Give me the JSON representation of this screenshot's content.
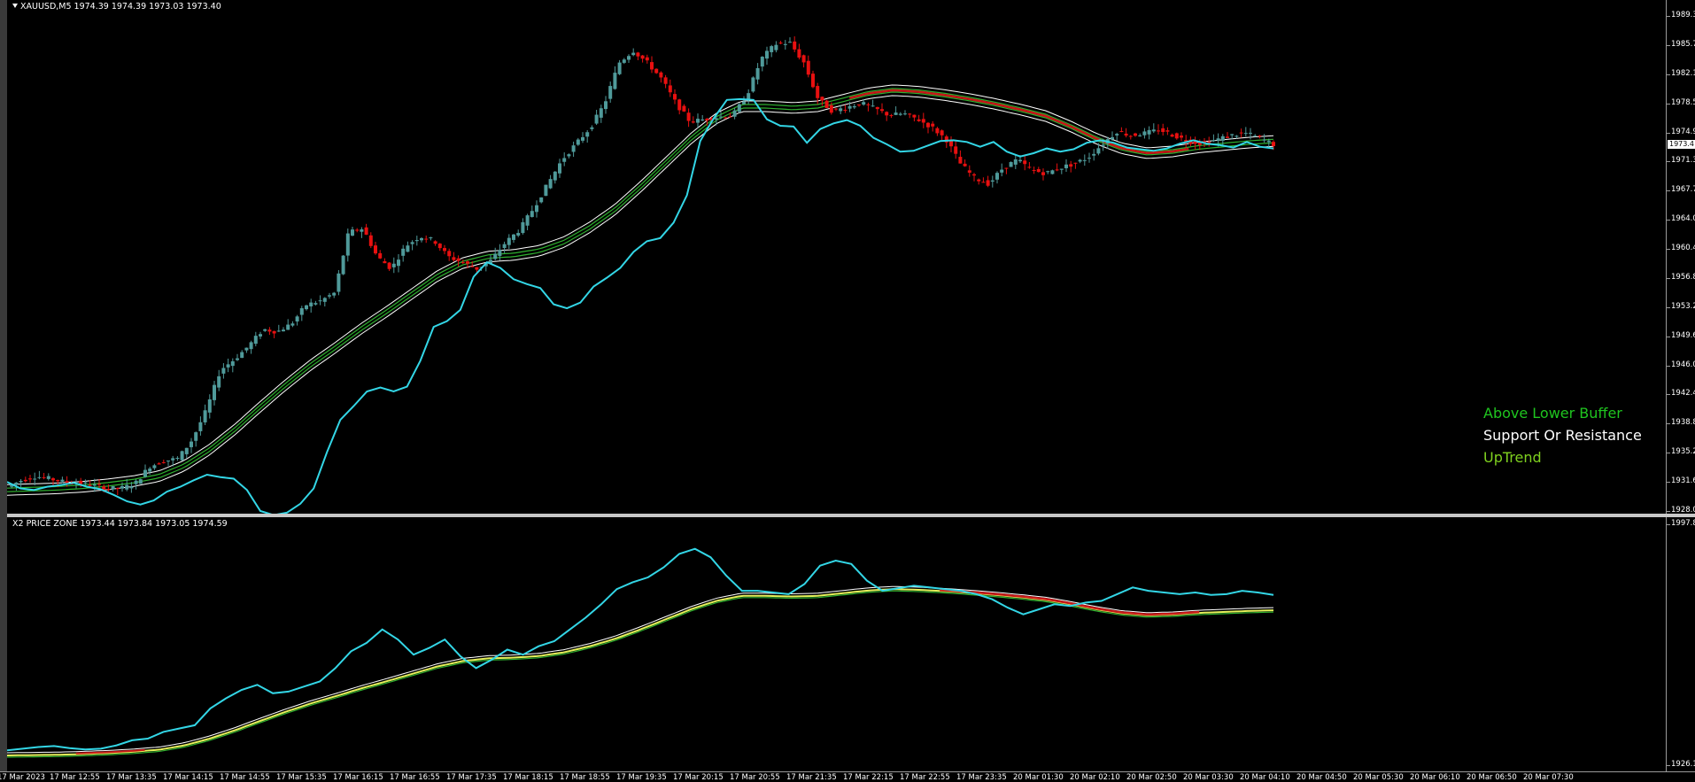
{
  "window": {
    "symbol_header": "XAUUSD,M5  1974.39 1974.39 1973.03 1973.40",
    "subwindow_header": "X2 PRICE ZONE 1973.44 1973.84 1973.05 1974.59",
    "current_price": "1973.4"
  },
  "legend": {
    "line1": "Above Lower Buffer",
    "line2": "Support Or Resistance",
    "line3": "UpTrend",
    "color1": "#1fc51f",
    "color2": "#ffffff",
    "color3": "#7fd11f"
  },
  "colors": {
    "bull": "#4f9a9a",
    "bear": "#e81010",
    "cyan": "#33d6e6",
    "ema_white": "#ffffff",
    "ema_green": "#2fb02f",
    "ema_red": "#c81818",
    "zone_yellow": "#e6f05a"
  },
  "main_axis": {
    "labels": [
      "1989.3",
      "1985.7",
      "1982.1",
      "1978.5",
      "1974.9",
      "1971.3",
      "1967.7",
      "1964.0",
      "1960.4",
      "1956.8",
      "1953.2",
      "1949.6",
      "1946.0",
      "1942.4",
      "1938.8",
      "1935.2",
      "1931.6",
      "1928.0"
    ],
    "min": 1928.0,
    "max": 1989.3
  },
  "sub_axis": {
    "labels": [
      "1997.8",
      "1926.1"
    ],
    "min": 1926.1,
    "max": 1997.8
  },
  "time_axis": {
    "labels": [
      "17 Mar 2023",
      "17 Mar 12:55",
      "17 Mar 13:35",
      "17 Mar 14:15",
      "17 Mar 14:55",
      "17 Mar 15:35",
      "17 Mar 16:15",
      "17 Mar 16:55",
      "17 Mar 17:35",
      "17 Mar 18:15",
      "17 Mar 18:55",
      "17 Mar 19:35",
      "17 Mar 20:15",
      "17 Mar 20:55",
      "17 Mar 21:35",
      "17 Mar 22:15",
      "17 Mar 22:55",
      "17 Mar 23:35",
      "20 Mar 01:30",
      "20 Mar 02:10",
      "20 Mar 02:50",
      "20 Mar 03:30",
      "20 Mar 04:10",
      "20 Mar 04:50",
      "20 Mar 05:30",
      "20 Mar 06:10",
      "20 Mar 06:50",
      "20 Mar 07:30"
    ]
  },
  "chart_data": {
    "type": "line",
    "close_anchors": [
      1931.0,
      1931.8,
      1932.3,
      1932.0,
      1931.6,
      1931.5,
      1931.2,
      1930.8,
      1930.8,
      1931.4,
      1933.5,
      1934.2,
      1934.5,
      1936.8,
      1940.5,
      1945.5,
      1946.8,
      1948.5,
      1950.5,
      1950.2,
      1951.2,
      1953.5,
      1954.0,
      1955.0,
      1962.5,
      1963.0,
      1959.5,
      1958.0,
      1960.8,
      1962.0,
      1961.5,
      1959.5,
      1958.8,
      1958.0,
      1959.0,
      1961.2,
      1962.8,
      1965.5,
      1968.5,
      1971.5,
      1973.5,
      1975.5,
      1978.5,
      1983.5,
      1985.0,
      1983.5,
      1981.5,
      1978.5,
      1976.2,
      1976.5,
      1976.8,
      1977.0,
      1979.5,
      1984.0,
      1985.8,
      1986.0,
      1983.5,
      1979.0,
      1977.5,
      1978.0,
      1978.5,
      1977.8,
      1977.0,
      1977.2,
      1976.5,
      1975.5,
      1974.0,
      1971.0,
      1969.2,
      1968.5,
      1970.5,
      1971.5,
      1970.2,
      1969.8,
      1970.5,
      1971.0,
      1971.8,
      1973.5,
      1975.0,
      1974.5,
      1974.8,
      1975.2,
      1974.5,
      1973.8,
      1973.5,
      1974.0,
      1974.5,
      1974.8,
      1974.2,
      1973.4
    ],
    "ema": [
      1930.5,
      1930.6,
      1930.7,
      1930.9,
      1931.2,
      1931.6,
      1932.2,
      1933.5,
      1935.5,
      1938.0,
      1940.8,
      1943.5,
      1946.0,
      1948.2,
      1950.5,
      1952.6,
      1954.8,
      1957.0,
      1958.6,
      1959.4,
      1959.6,
      1960.1,
      1961.2,
      1963.0,
      1965.2,
      1968.0,
      1971.0,
      1974.0,
      1976.5,
      1978.0,
      1978.0,
      1977.8,
      1978.0,
      1978.8,
      1979.6,
      1980.0,
      1979.8,
      1979.4,
      1978.9,
      1978.3,
      1977.6,
      1976.8,
      1975.5,
      1974.0,
      1972.8,
      1972.2,
      1972.4,
      1972.9,
      1973.2,
      1973.5,
      1973.7
    ],
    "bollinger_lower": [
      1931.6,
      1930.8,
      1930.6,
      1931.0,
      1931.2,
      1931.5,
      1931.0,
      1930.7,
      1930.0,
      1929.2,
      1928.8,
      1929.3,
      1930.4,
      1931.0,
      1931.8,
      1932.5,
      1932.2,
      1932.0,
      1930.6,
      1928.0,
      1927.5,
      1927.8,
      1928.9,
      1930.8,
      1935.3,
      1939.3,
      1941.0,
      1942.8,
      1943.3,
      1942.8,
      1943.4,
      1946.6,
      1950.8,
      1951.5,
      1952.9,
      1957.0,
      1958.8,
      1958.1,
      1956.7,
      1956.1,
      1955.6,
      1953.6,
      1953.1,
      1953.8,
      1955.8,
      1956.9,
      1958.1,
      1960.1,
      1961.4,
      1961.8,
      1963.7,
      1967.1,
      1973.8,
      1976.6,
      1978.9,
      1979.0,
      1978.9,
      1976.5,
      1975.7,
      1975.6,
      1973.6,
      1975.3,
      1976.0,
      1976.4,
      1975.7,
      1974.2,
      1973.4,
      1972.5,
      1972.6,
      1973.2,
      1973.8,
      1973.9,
      1973.7,
      1973.1,
      1973.7,
      1972.5,
      1971.9,
      1972.3,
      1972.9,
      1972.5,
      1972.8,
      1973.6,
      1973.9,
      1973.6,
      1973.0,
      1972.8,
      1972.6,
      1972.9,
      1973.5,
      1973.9,
      1973.5,
      1973.3,
      1973.0,
      1973.7,
      1973.1,
      1972.9
    ],
    "cyan_sub": [
      1930.5,
      1931.0,
      1931.5,
      1931.8,
      1931.2,
      1930.8,
      1931.0,
      1932.0,
      1933.5,
      1934.0,
      1936.0,
      1937.0,
      1938.0,
      1943.0,
      1946.0,
      1948.5,
      1950.0,
      1947.5,
      1948.0,
      1949.5,
      1951.0,
      1955.0,
      1960.0,
      1962.5,
      1966.5,
      1963.5,
      1959.0,
      1961.0,
      1963.5,
      1958.5,
      1955.0,
      1957.5,
      1960.5,
      1959.0,
      1961.5,
      1963.0,
      1966.5,
      1970.0,
      1974.0,
      1978.5,
      1980.5,
      1982.0,
      1985.0,
      1989.0,
      1990.5,
      1988.0,
      1982.5,
      1978.0,
      1978.0,
      1977.5,
      1977.0,
      1980.0,
      1985.5,
      1987.0,
      1986.0,
      1981.0,
      1978.0,
      1978.8,
      1979.5,
      1979.0,
      1978.5,
      1978.0,
      1977.0,
      1975.5,
      1973.0,
      1971.0,
      1972.5,
      1974.0,
      1973.5,
      1974.5,
      1975.0,
      1977.0,
      1979.0,
      1978.0,
      1977.5,
      1977.0,
      1977.5,
      1976.8,
      1977.0,
      1978.0,
      1977.5,
      1976.8
    ]
  }
}
